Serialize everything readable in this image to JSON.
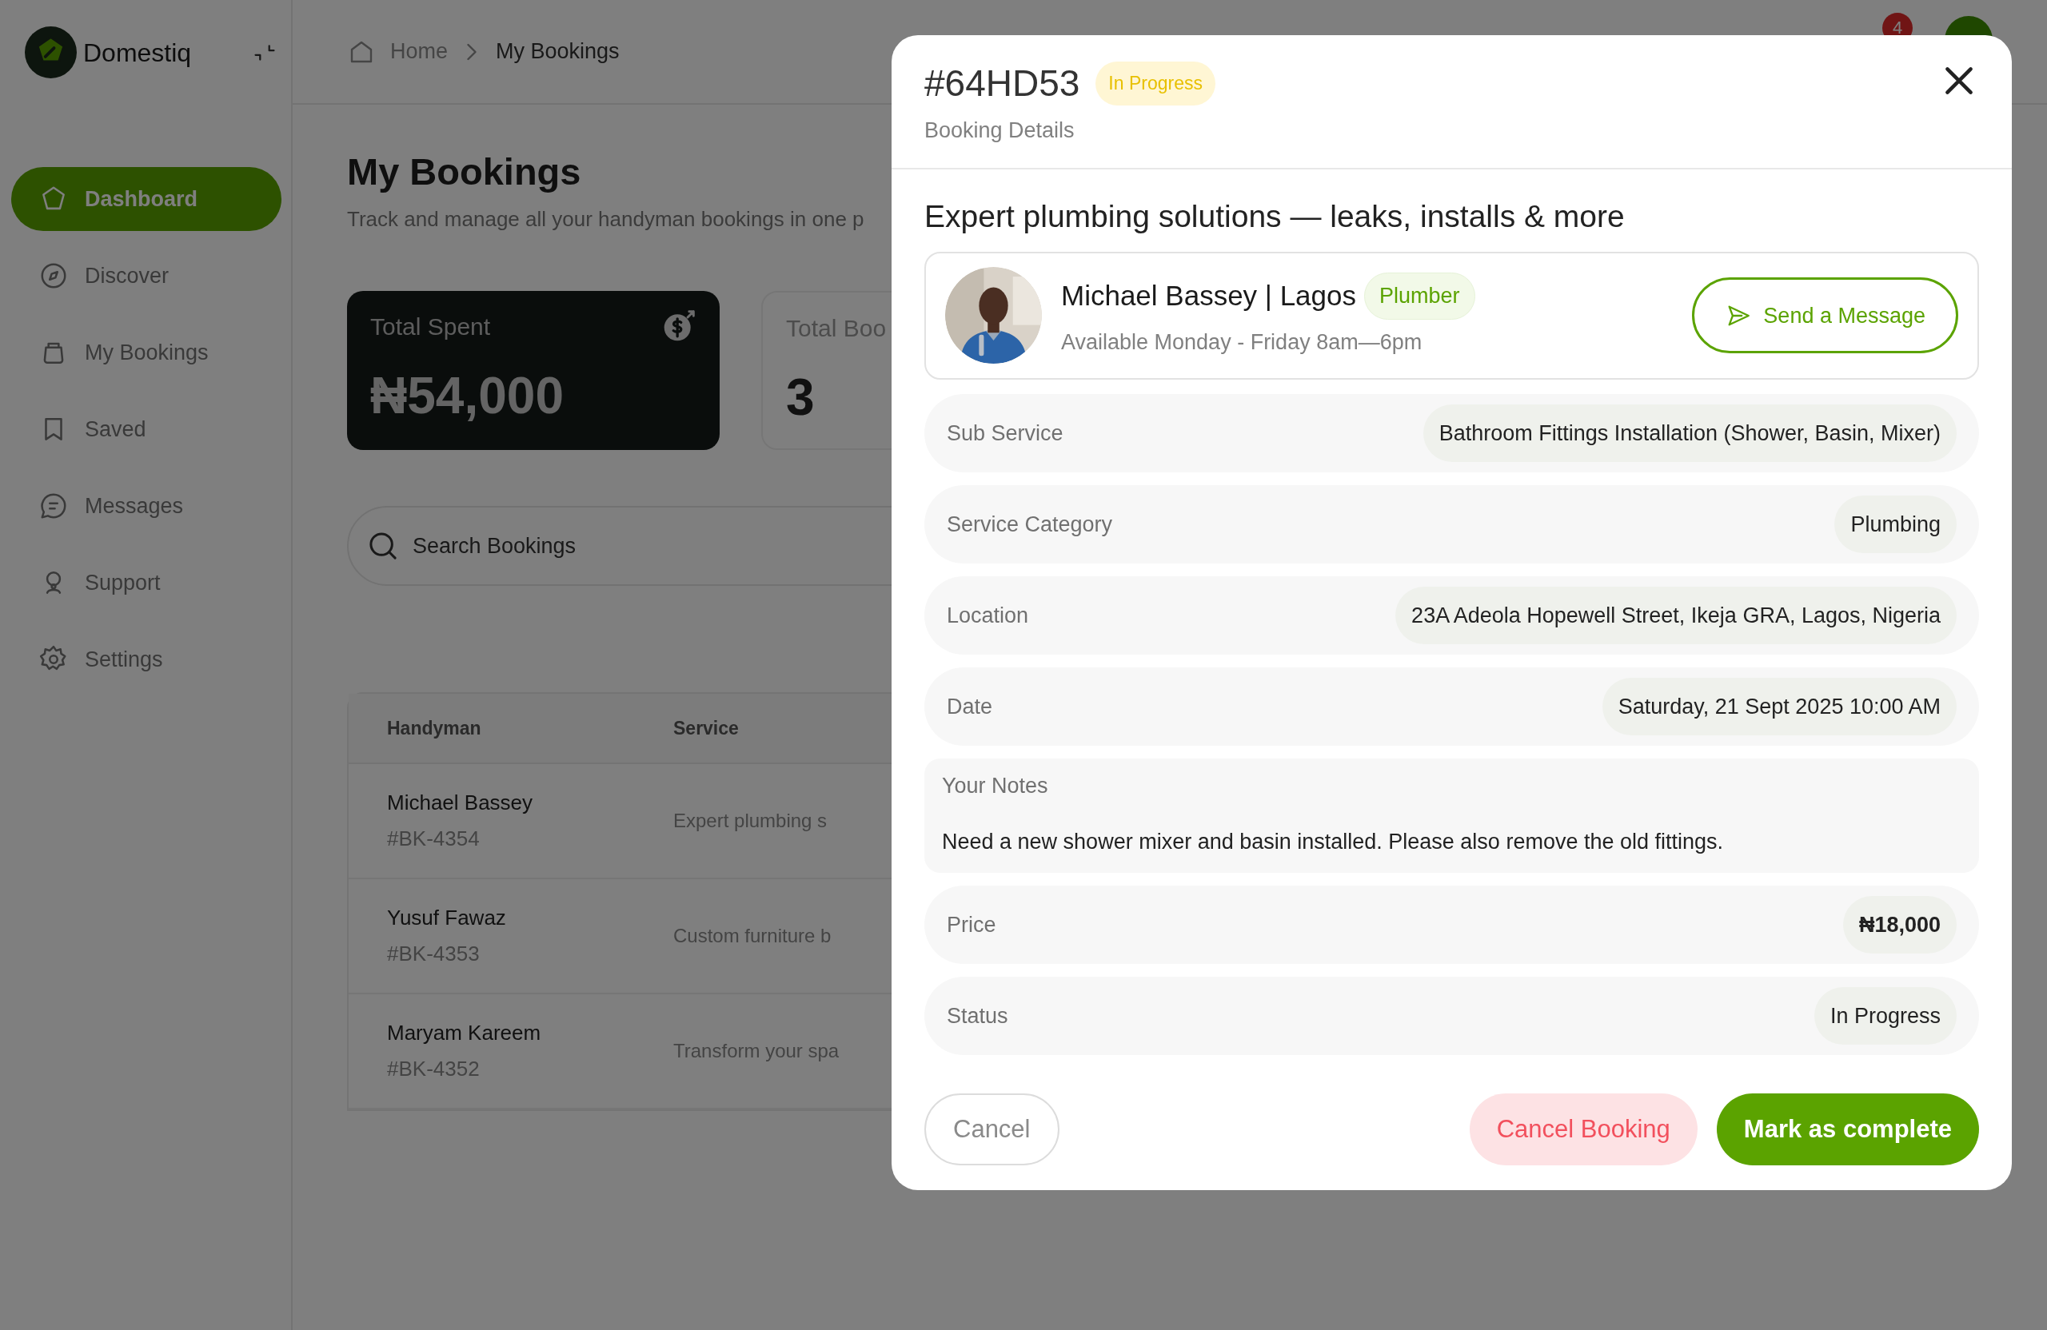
{
  "sidebar": {
    "brand": "Domestiq",
    "items": [
      {
        "label": "Dashboard",
        "selected": true
      },
      {
        "label": "Discover",
        "selected": false
      },
      {
        "label": "My Bookings",
        "selected": false
      },
      {
        "label": "Saved",
        "selected": false
      },
      {
        "label": "Messages",
        "selected": false
      },
      {
        "label": "Support",
        "selected": false
      },
      {
        "label": "Settings",
        "selected": false
      }
    ]
  },
  "breadcrumb": [
    "Home",
    "My Bookings"
  ],
  "notifications": {
    "count": "4"
  },
  "page": {
    "title": "My Bookings",
    "subtitle": "Track and manage all your handyman bookings in one p"
  },
  "stats": [
    {
      "kind": "dark",
      "label": "Total Spent",
      "value": "₦54,000"
    },
    {
      "kind": "light",
      "label": "Total Boo",
      "value": "3"
    }
  ],
  "search": {
    "placeholder": "Search Bookings"
  },
  "table": {
    "columns": [
      "Handyman",
      "Service"
    ],
    "rows": [
      {
        "name": "Michael Bassey",
        "id": "#BK-4354",
        "service": "Expert plumbing s"
      },
      {
        "name": "Yusuf Fawaz",
        "id": "#BK-4353",
        "service": "Custom furniture b"
      },
      {
        "name": "Maryam Kareem",
        "id": "#BK-4352",
        "service": "Transform your spa"
      }
    ]
  },
  "modal": {
    "id": "#64HD53",
    "status_badge": "In Progress",
    "subtitle": "Booking Details",
    "title": "Expert plumbing solutions — leaks, installs & more",
    "provider": {
      "kind": "picture",
      "name": "Michael Bassey | Lagos",
      "role": "Plumber",
      "availability": "Available Monday - Friday 8am—6pm",
      "message_button": "Send a Message"
    },
    "details": [
      {
        "kind": "row",
        "label": "Sub Service",
        "value": "Bathroom Fittings Installation (Shower, Basin, Mixer)"
      },
      {
        "kind": "row",
        "label": "Service Category",
        "value": "Plumbing"
      },
      {
        "kind": "row",
        "label": "Location",
        "value": "23A Adeola Hopewell Street, Ikeja GRA, Lagos, Nigeria"
      },
      {
        "kind": "row",
        "label": "Date",
        "value": "Saturday, 21 Sept 2025 10:00 AM"
      },
      {
        "kind": "notes",
        "label": "Your Notes",
        "value": "Need a new shower mixer and basin installed. Please also remove the old fittings."
      },
      {
        "kind": "price",
        "label": "Price",
        "value": "₦18,000"
      },
      {
        "kind": "row",
        "label": "Status",
        "value": "In Progress"
      }
    ],
    "buttons": [
      {
        "kind": "outline",
        "label": "Cancel"
      },
      {
        "kind": "danger",
        "label": "Cancel Booking"
      },
      {
        "kind": "primary",
        "label": "Mark as complete"
      }
    ]
  }
}
